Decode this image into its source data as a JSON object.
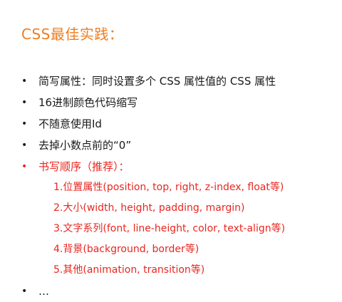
{
  "title": "CSS最佳实践：",
  "bullets": [
    {
      "marker": "•",
      "text": "简写属性：同时设置多个 CSS 属性值的 CSS 属性"
    },
    {
      "marker": "•",
      "text": "16进制颜色代码缩写"
    },
    {
      "marker": "•",
      "text": "不随意使用Id"
    },
    {
      "marker": "•",
      "text": "去掉小数点前的“0”"
    },
    {
      "marker": "•",
      "text": "书写顺序（推荐）："
    }
  ],
  "order_items": [
    {
      "num": "1.",
      "text": "位置属性(position, top, right, z-index, float等)"
    },
    {
      "num": "2.",
      "text": "大小(width, height, padding, margin)"
    },
    {
      "num": "3.",
      "text": "文字系列(font, line-height, color, text-align等)"
    },
    {
      "num": "4.",
      "text": "背景(background, border等)"
    },
    {
      "num": "5.",
      "text": "其他(animation, transition等)"
    }
  ],
  "last_bullet": {
    "marker": "•",
    "text": "…"
  },
  "colors": {
    "title": "#f07c1e",
    "highlight": "#e8261f",
    "body_text": "#1a1a1a"
  }
}
